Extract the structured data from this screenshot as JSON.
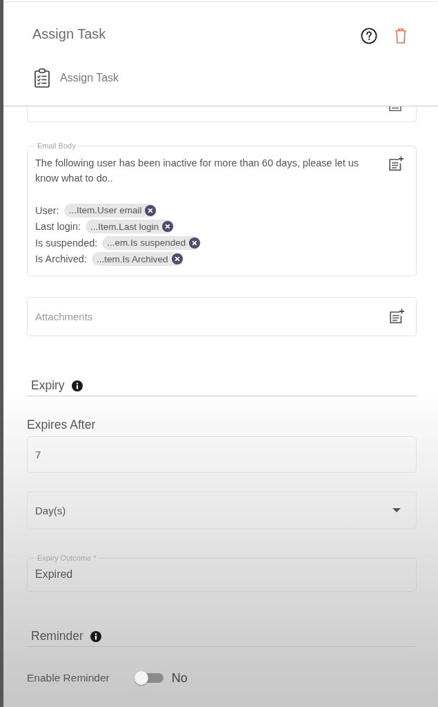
{
  "header": {
    "title": "Assign Task",
    "subtitle": "Assign Task"
  },
  "email_body": {
    "label": "Email Body",
    "text": "The following user has been inactive for more than 60 days, please let us know what to do..",
    "variables": [
      {
        "label": "User:",
        "token": "...Item.User email"
      },
      {
        "label": "Last login:",
        "token": "...Item.Last login"
      },
      {
        "label": "Is suspended:",
        "token": "...em.Is suspended"
      },
      {
        "label": "Is Archived:",
        "token": "...tem.Is Archived"
      }
    ]
  },
  "attachments": {
    "placeholder": "Attachments"
  },
  "expiry": {
    "heading": "Expiry",
    "expires_after": {
      "label": "Expires After",
      "value": "7"
    },
    "unit": {
      "value": "Day(s)"
    },
    "outcome": {
      "label": "Expiry Outcome *",
      "value": "Expired"
    }
  },
  "reminder": {
    "heading": "Reminder",
    "enable": {
      "label": "Enable Reminder",
      "on": false,
      "state_text": "No"
    }
  }
}
